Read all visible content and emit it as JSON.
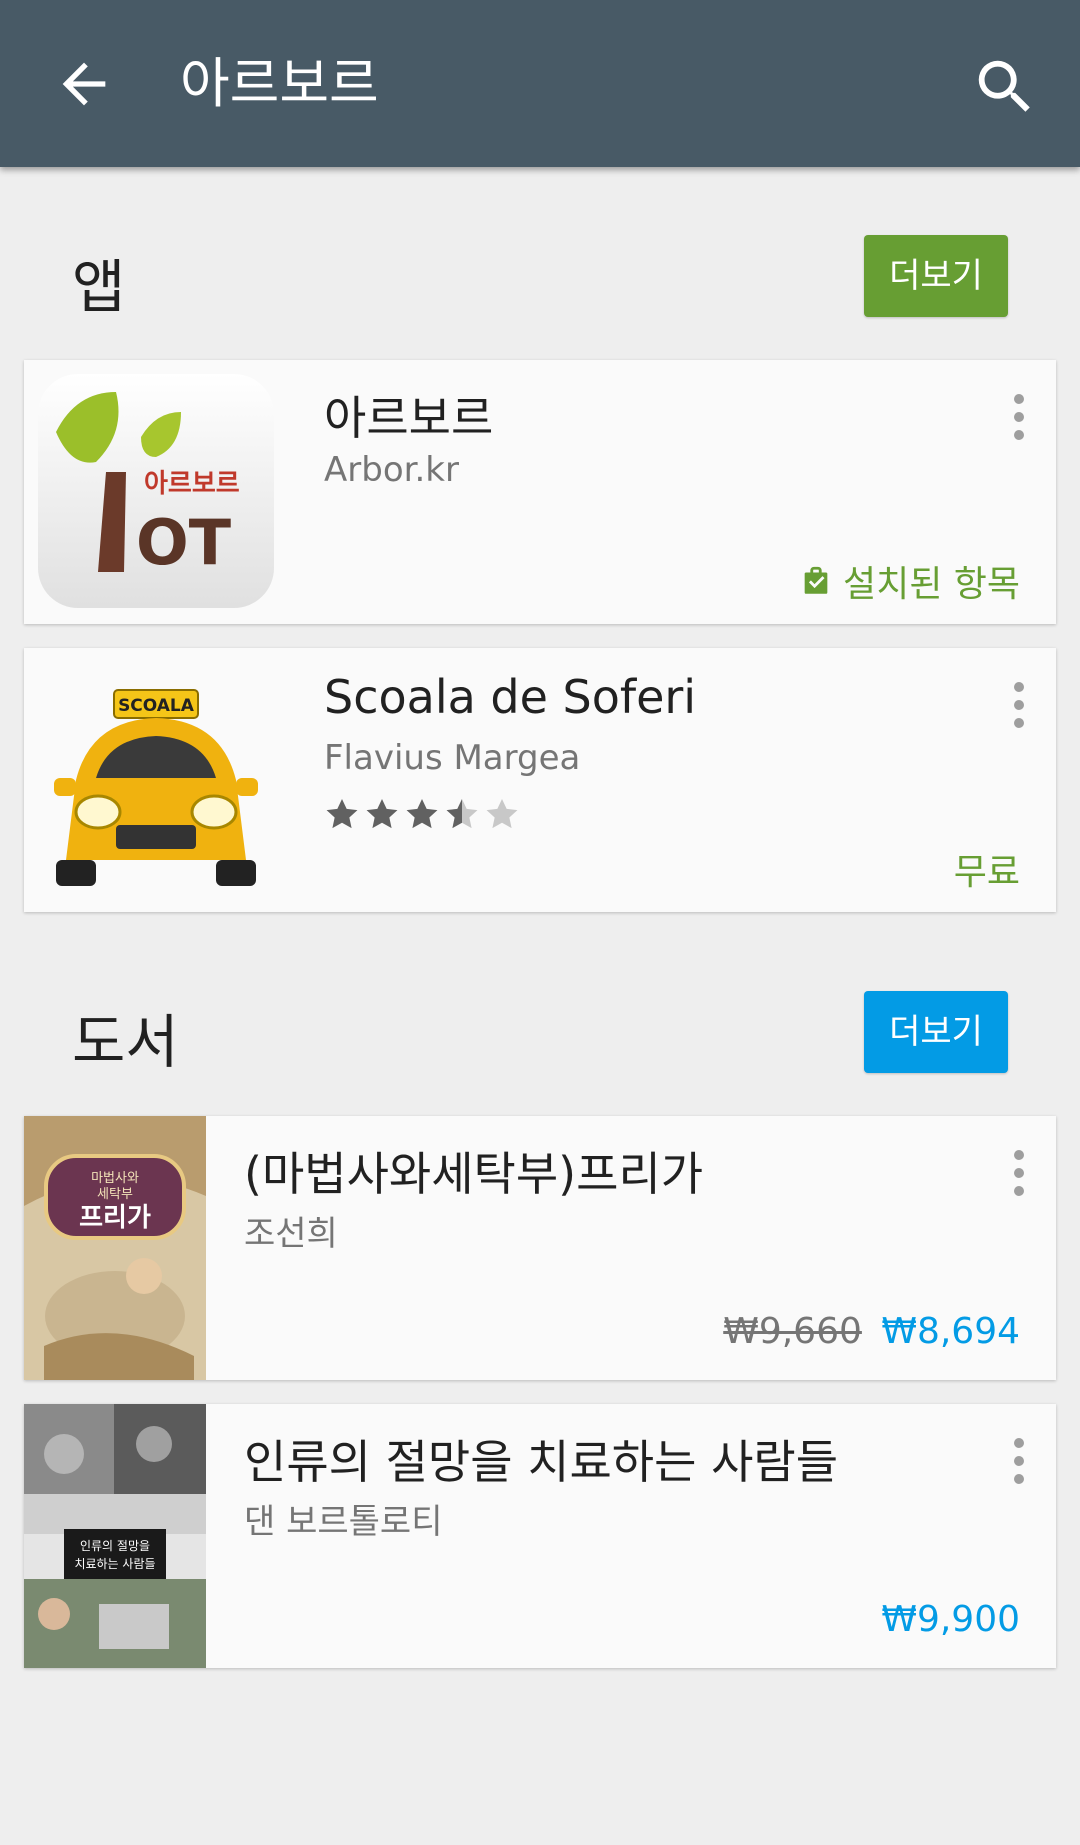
{
  "appbar": {
    "title": "아르보르",
    "back_icon": "back-arrow-icon",
    "search_icon": "search-icon"
  },
  "sections": {
    "apps": {
      "title": "앱",
      "more_label": "더보기",
      "more_color": "#679e33"
    },
    "books": {
      "title": "도서",
      "more_label": "더보기",
      "more_color": "#039be5"
    }
  },
  "apps": [
    {
      "name": "아르보르",
      "developer": "Arbor.kr",
      "status": "설치된 항목",
      "status_color": "#679e33"
    },
    {
      "name": "Scoala de Soferi",
      "developer": "Flavius Margea",
      "rating": 3.5,
      "price": "무료",
      "price_color": "#679e33"
    }
  ],
  "books": [
    {
      "title": "(마법사와세탁부)프리가",
      "author": "조선희",
      "original_price": "₩9,660",
      "price": "₩8,694",
      "price_color": "#039be5",
      "cover_text": [
        "마법사와",
        "세탁부",
        "프리가"
      ]
    },
    {
      "title": "인류의 절망을 치료하는 사람들",
      "author": "댄 보르톨로티",
      "price": "₩9,900",
      "price_color": "#039be5",
      "cover_text": [
        "인류의 절망을",
        "치료하는 사람들"
      ]
    }
  ],
  "logo_text": {
    "arbor_logo": "아르보르",
    "taxi_sign": "SCOALA"
  }
}
